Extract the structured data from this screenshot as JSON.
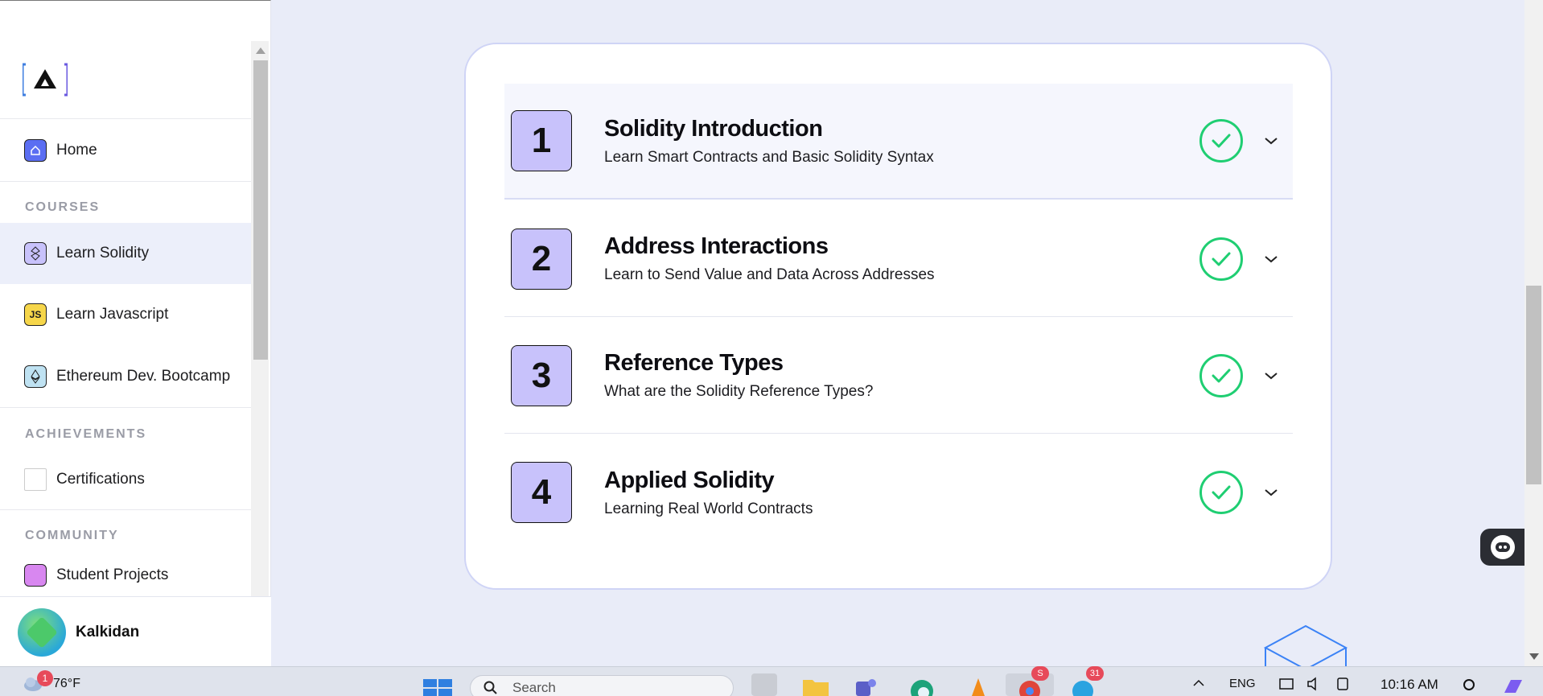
{
  "sidebar": {
    "nav": {
      "home": "Home",
      "courses_label": "COURSES",
      "learn_solidity": "Learn Solidity",
      "learn_javascript": "Learn Javascript",
      "js_icon_text": "JS",
      "ethereum_bootcamp": "Ethereum Dev. Bootcamp",
      "achievements_label": "ACHIEVEMENTS",
      "certifications": "Certifications",
      "community_label": "COMMUNITY",
      "student_projects": "Student Projects"
    },
    "user": {
      "name": "Kalkidan"
    }
  },
  "main": {
    "modules": [
      {
        "number": "1",
        "title": "Solidity Introduction",
        "subtitle": "Learn Smart Contracts and Basic Solidity Syntax",
        "completed": true
      },
      {
        "number": "2",
        "title": "Address Interactions",
        "subtitle": "Learn to Send Value and Data Across Addresses",
        "completed": true
      },
      {
        "number": "3",
        "title": "Reference Types",
        "subtitle": "What are the Solidity Reference Types?",
        "completed": true
      },
      {
        "number": "4",
        "title": "Applied Solidity",
        "subtitle": "Learning Real World Contracts",
        "completed": true
      }
    ]
  },
  "colors": {
    "accent_purple": "#c8c2fb",
    "check_green": "#1fce72",
    "page_bg": "#e9ecf8"
  },
  "taskbar": {
    "weather_temp": "76°F",
    "weather_badge": "1",
    "search_placeholder": "Search",
    "language": "ENG",
    "time": "10:16 AM",
    "chrome_badge": "S",
    "telegram_badge": "31"
  }
}
